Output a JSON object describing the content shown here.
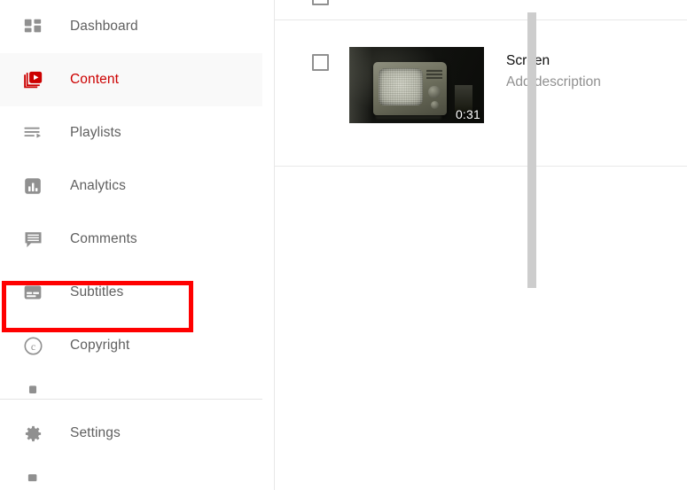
{
  "sidebar": {
    "items": [
      {
        "label": "Dashboard",
        "icon": "dashboard-icon",
        "active": false
      },
      {
        "label": "Content",
        "icon": "content-icon",
        "active": true
      },
      {
        "label": "Playlists",
        "icon": "playlists-icon",
        "active": false
      },
      {
        "label": "Analytics",
        "icon": "analytics-icon",
        "active": false
      },
      {
        "label": "Comments",
        "icon": "comments-icon",
        "active": false
      },
      {
        "label": "Subtitles",
        "icon": "subtitles-icon",
        "active": false
      },
      {
        "label": "Copyright",
        "icon": "copyright-icon",
        "active": false
      }
    ],
    "footer_items": [
      {
        "label": "Settings",
        "icon": "gear-icon"
      }
    ],
    "active_color": "#cc0000",
    "label_color": "#606060",
    "icon_color": "#909090",
    "highlight_color": "#ff0000",
    "highlighted_item": "Subtitles"
  },
  "main": {
    "videos": [
      {
        "title": "Screen",
        "description": "Add description",
        "duration": "0:31",
        "checkbox_checked": false,
        "thumbnail_alt": "dark room with vintage CRT television showing static"
      }
    ]
  }
}
